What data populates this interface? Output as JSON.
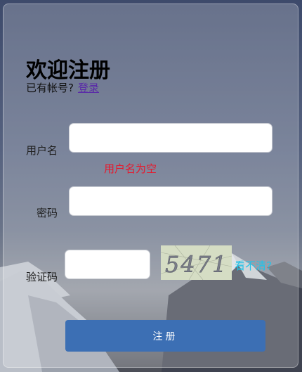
{
  "form": {
    "title": "欢迎注册",
    "has_account_text": "已有帐号?",
    "login_link": "登录",
    "username_label": "用户名",
    "username_value": "",
    "username_error": "用户名为空",
    "password_label": "密码",
    "password_value": "",
    "captcha_label": "验证码",
    "captcha_value": "",
    "captcha_image_text": "5471",
    "refresh_captcha_link": "看不清?",
    "submit_label": "注册"
  },
  "colors": {
    "error": "#e8182c",
    "link": "#5a2aa8",
    "refresh_link": "#22c3e8",
    "submit_bg": "#3c6fb4"
  }
}
